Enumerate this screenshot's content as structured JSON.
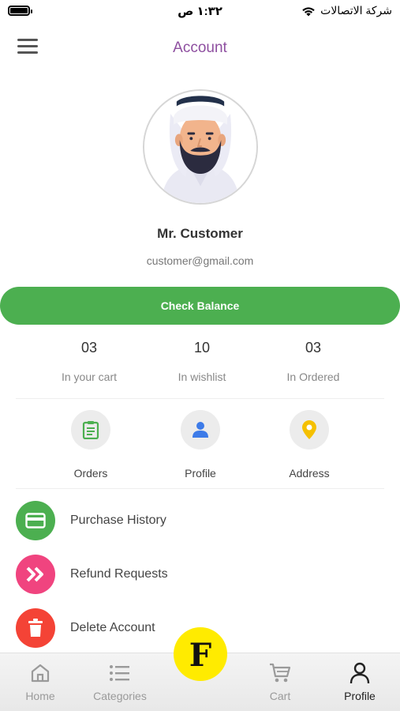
{
  "status_bar": {
    "time": "١:٣٢ ص",
    "carrier": "شركة الاتصالات",
    "wifi_icon": "wifi-icon",
    "battery_icon": "battery-icon"
  },
  "header": {
    "title": "Account",
    "menu_icon": "hamburger-menu-icon"
  },
  "profile": {
    "name": "Mr. Customer",
    "email": "customer@gmail.com",
    "avatar_icon": "man-avatar"
  },
  "check_balance_label": "Check Balance",
  "stats": [
    {
      "value": "03",
      "label": "In your cart"
    },
    {
      "value": "10",
      "label": "In wishlist"
    },
    {
      "value": "03",
      "label": "In Ordered"
    }
  ],
  "shortcuts": [
    {
      "label": "Orders",
      "icon": "clipboard-icon",
      "color": "#4caf50"
    },
    {
      "label": "Profile",
      "icon": "person-icon",
      "color": "#3d7be8"
    },
    {
      "label": "Address",
      "icon": "location-pin-icon",
      "color": "#f5c000"
    }
  ],
  "menu": [
    {
      "label": "Purchase History",
      "icon": "credit-card-icon",
      "color": "#4caf50"
    },
    {
      "label": "Refund Requests",
      "icon": "double-chevron-icon",
      "color": "#f0447f"
    },
    {
      "label": "Delete Account",
      "icon": "trash-icon",
      "color": "#f44336"
    }
  ],
  "bottom_nav": {
    "items": [
      {
        "label": "Home",
        "icon": "home-icon"
      },
      {
        "label": "Categories",
        "icon": "list-icon"
      },
      {
        "label": "Cart",
        "icon": "cart-icon"
      },
      {
        "label": "Profile",
        "icon": "user-icon"
      }
    ],
    "active": "Profile",
    "center_logo": "F"
  },
  "colors": {
    "accent_purple": "#8e4fa0",
    "green": "#4caf50",
    "yellow_fab": "#ffeb00"
  }
}
